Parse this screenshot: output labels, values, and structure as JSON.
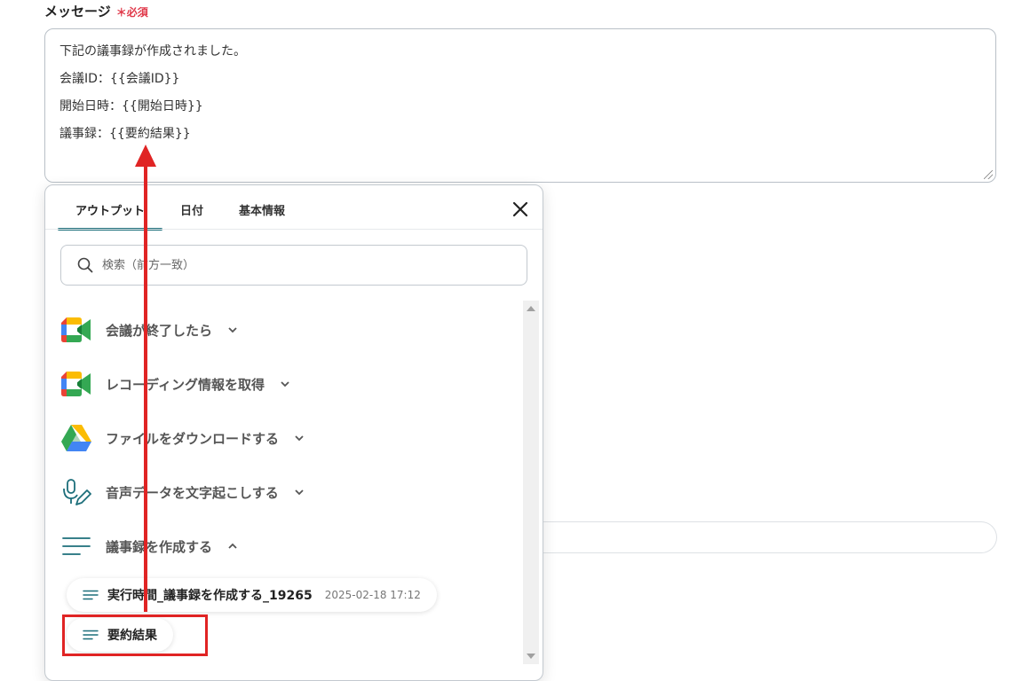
{
  "field": {
    "label": "メッセージ",
    "required_mark": "＊必須"
  },
  "message_lines": [
    "下記の議事録が作成されました。",
    "会議ID：{{会議ID}}",
    "開始日時：{{開始日時}}",
    "議事録：{{要約結果}}"
  ],
  "popup": {
    "tabs": [
      {
        "label": "アウトプット"
      },
      {
        "label": "日付"
      },
      {
        "label": "基本情報"
      }
    ],
    "search_placeholder": "検索（前方一致）",
    "sections": [
      {
        "title": "会議が終了したら",
        "icon": "google-meet-icon"
      },
      {
        "title": "レコーディング情報を取得",
        "icon": "google-meet-icon"
      },
      {
        "title": "ファイルをダウンロードする",
        "icon": "google-drive-icon"
      },
      {
        "title": "音声データを文字起こしする",
        "icon": "microphone-pen-icon"
      },
      {
        "title": "議事録を作成する",
        "icon": "text-lines-icon"
      }
    ],
    "items": [
      {
        "title": "実行時間_議事録を作成する_19265",
        "date": "2025-02-18 17:12"
      },
      {
        "title": "要約結果",
        "date": ""
      }
    ]
  },
  "colors": {
    "accent": "#1c6e7a",
    "required": "#e0394a",
    "annotation": "#e02424"
  }
}
